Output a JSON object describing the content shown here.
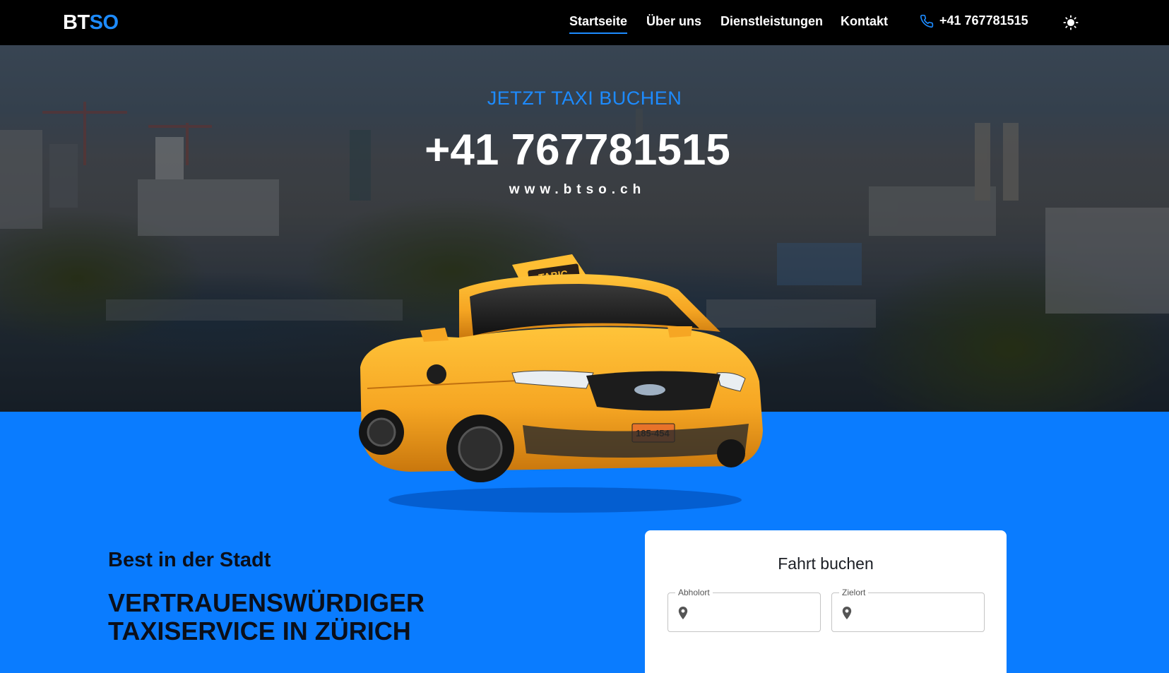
{
  "brand": {
    "logo_part1": "BT",
    "logo_part2": "SO",
    "color_primary": "#1d8bff"
  },
  "nav": {
    "items": [
      {
        "label": "Startseite",
        "active": true
      },
      {
        "label": "Über uns",
        "active": false
      },
      {
        "label": "Dienstleistungen",
        "active": false
      },
      {
        "label": "Kontakt",
        "active": false
      }
    ],
    "phone": "+41 767781515",
    "phone_icon": "phone-icon",
    "theme_icon": "sun-icon"
  },
  "hero": {
    "kicker": "JETZT TAXI BUCHEN",
    "phone": "+41 767781515",
    "website": "www.btso.ch",
    "taxi_sign": "TABIC",
    "plate": "185-454"
  },
  "about": {
    "tagline": "Best in der Stadt",
    "headline": "VERTRAUENSWÜRDIGER TAXISERVICE IN ZÜRICH"
  },
  "booking": {
    "title": "Fahrt buchen",
    "pickup_label": "Abholort",
    "pickup_value": "",
    "destination_label": "Zielort",
    "destination_value": "",
    "field_icon": "location-pin-icon"
  },
  "colors": {
    "section_bg": "#0a7cff",
    "navbar_bg": "#000000",
    "taxi_yellow": "#f6a623"
  }
}
